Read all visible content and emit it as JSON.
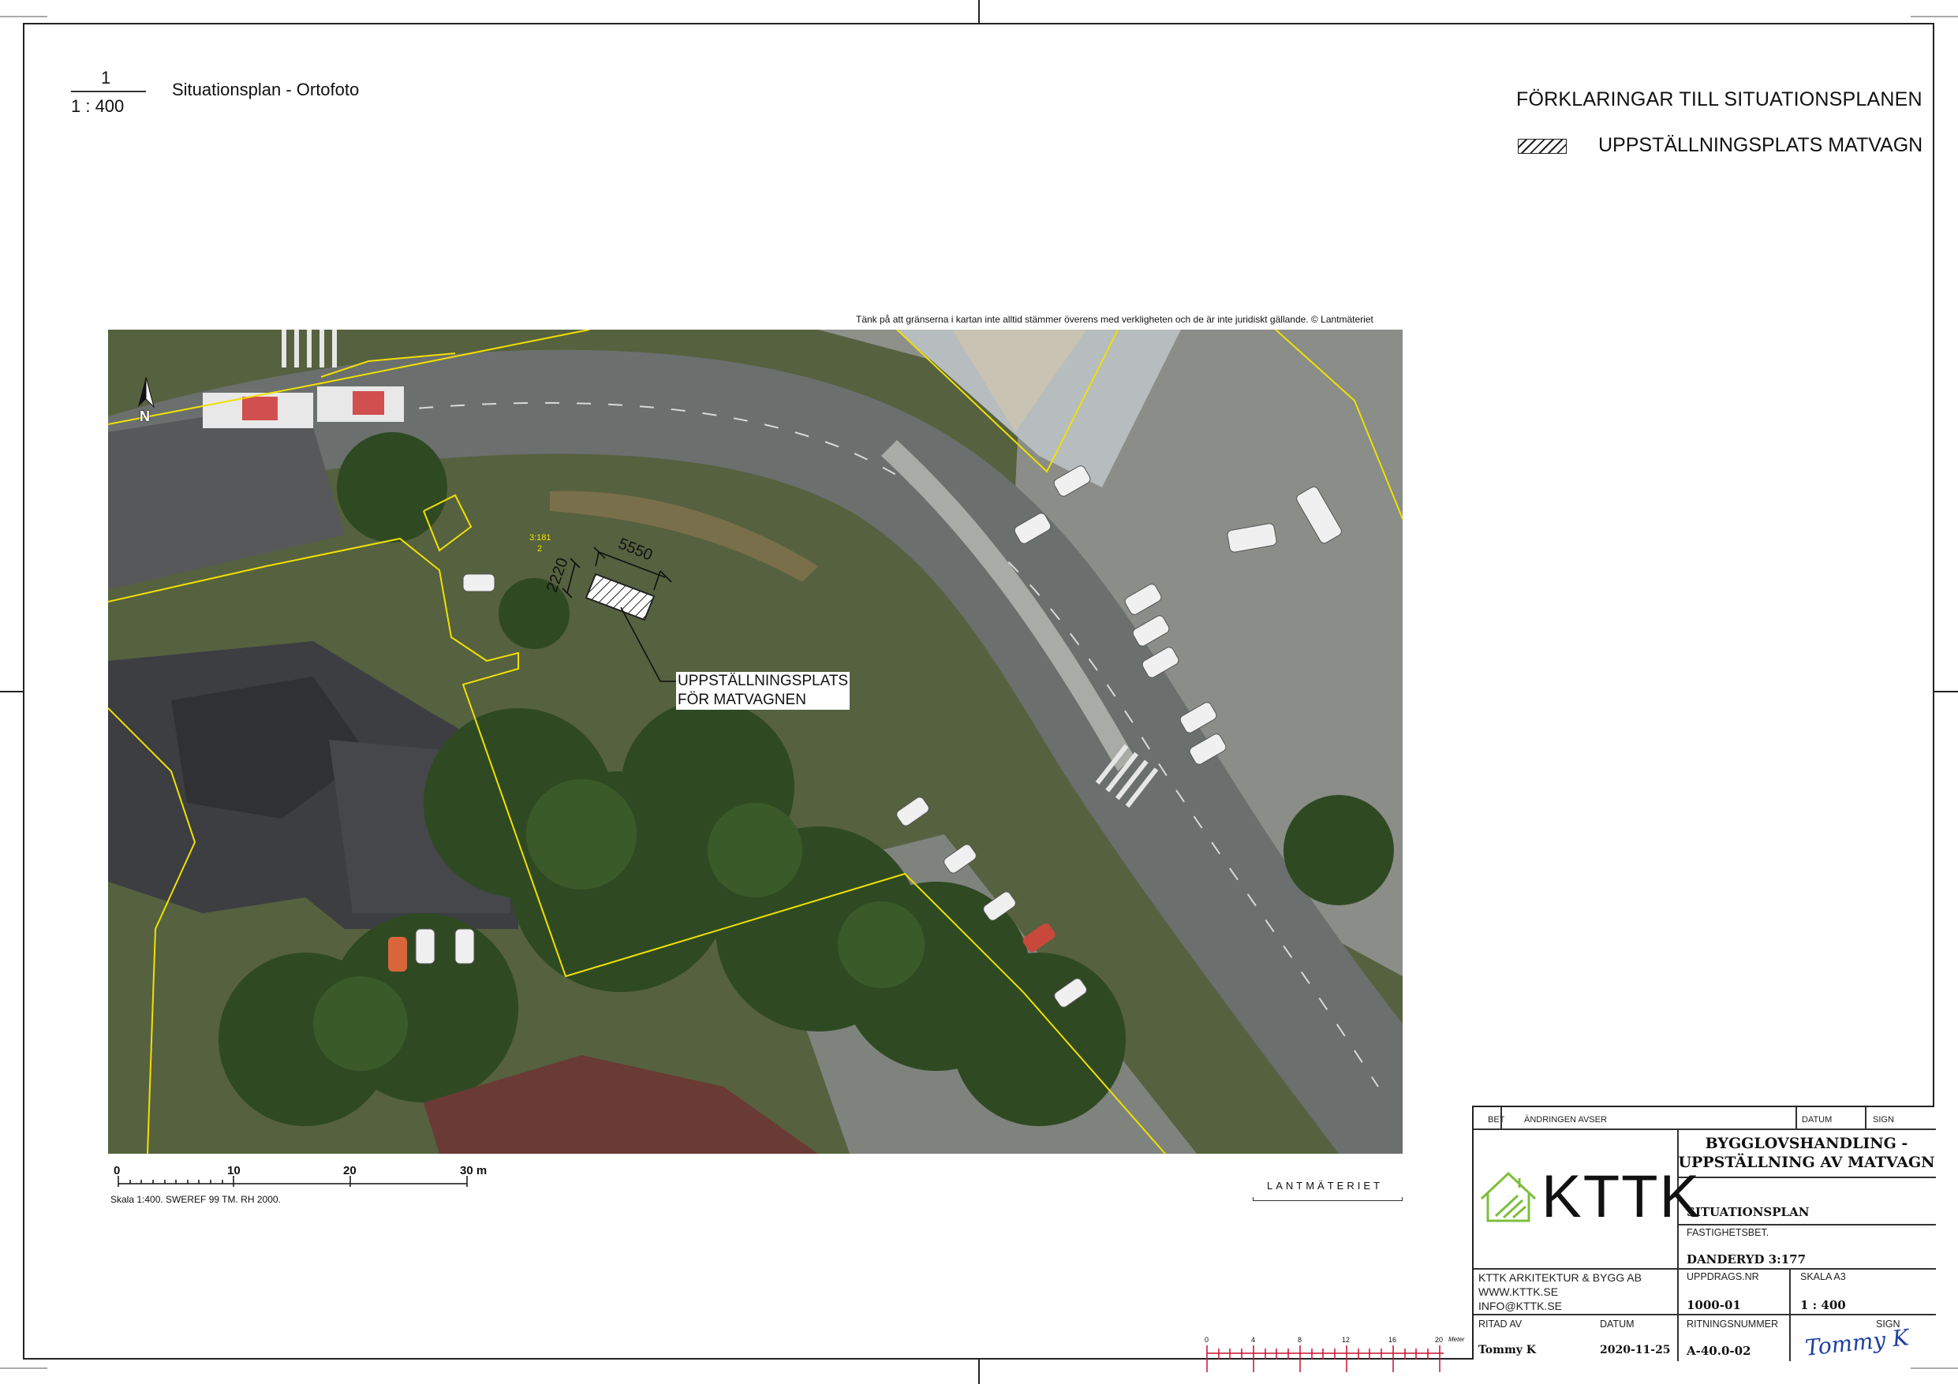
{
  "view": {
    "number": "1",
    "scale": "1 : 400",
    "title": "Situationsplan - Ortofoto"
  },
  "legend": {
    "title": "FÖRKLARINGAR TILL SITUATIONSPLANEN",
    "items": [
      {
        "label": "UPPSTÄLLNINGSPLATS MATVAGN"
      }
    ]
  },
  "map": {
    "disclaimer": "Tänk på att gränserna i kartan inte alltid stämmer överens med verkligheten och de är inte juridiskt gällande. © Lantmäteriet",
    "north": "N",
    "dimension_length": "5550",
    "dimension_width": "2220",
    "parcel_label": "3:181",
    "parcel_sub": "2",
    "callout_line1": "UPPSTÄLLNINGSPLATS",
    "callout_line2": "FÖR MATVAGNEN",
    "provider": "LANTMÄTERIET",
    "scalebar": {
      "ticks": [
        "0",
        "10",
        "20",
        "30 m"
      ],
      "caption": "Skala 1:400. SWEREF 99 TM. RH 2000."
    }
  },
  "red_scale": {
    "ticks": [
      "0",
      "4",
      "8",
      "12",
      "16",
      "20"
    ],
    "unit": "Meter"
  },
  "titleblock": {
    "headers": {
      "bet": "BET",
      "change": "ÄNDRINGEN AVSER",
      "date": "DATUM",
      "sign": "SIGN"
    },
    "project_title_1": "BYGGLOVSHANDLING -",
    "project_title_2": "UPPSTÄLLNING AV MATVAGN",
    "logo_text": "KTTK",
    "drawing_type": "SITUATIONSPLAN",
    "property_label": "FASTIGHETSBET.",
    "property_value": "DANDERYD 3:177",
    "company": [
      "KTTK ARKITEKTUR & BYGG AB",
      "WWW.KTTK.SE",
      "INFO@KTTK.SE"
    ],
    "assignment_label": "UPPDRAGS.NR",
    "assignment_value": "1000-01",
    "scale_label": "SKALA A3",
    "scale_value": "1 : 400",
    "drawn_by_label": "RITAD AV",
    "drawn_by_value": "Tommy K",
    "date_label": "DATUM",
    "date_value": "2020-11-25",
    "drawing_no_label": "RITNINGSNUMMER",
    "drawing_no_value": "A-40.0-02",
    "sign_label": "SIGN",
    "signature": "Tommy K"
  },
  "colors": {
    "boundary": "#f0e000",
    "scale_red": "#c8102e",
    "logo_green": "#7cbf3c"
  }
}
